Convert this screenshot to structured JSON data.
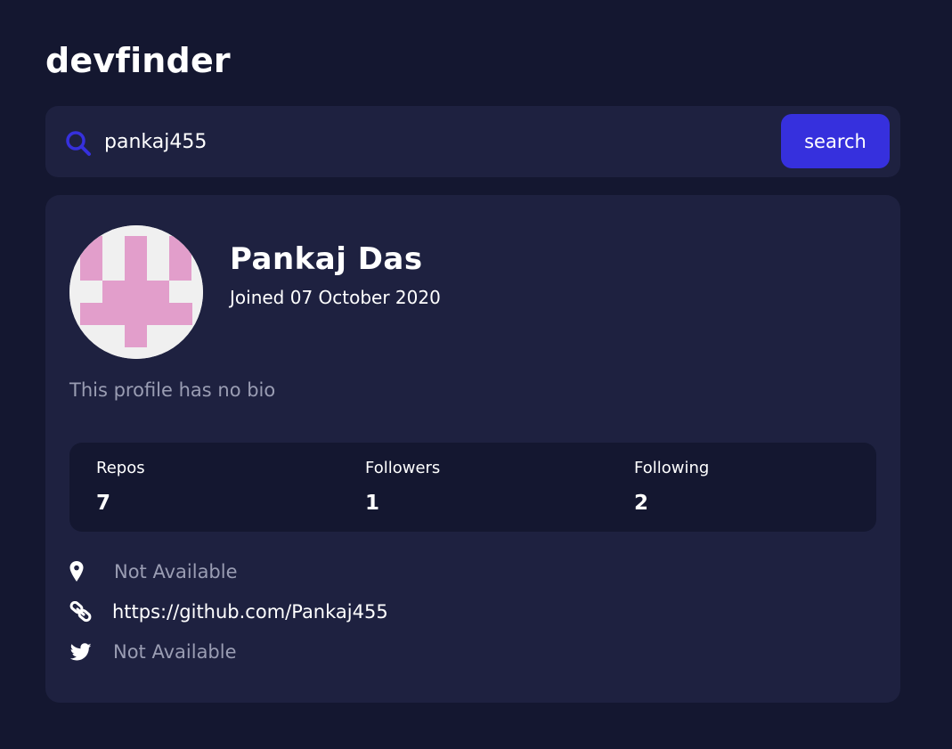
{
  "app": {
    "title": "devfinder"
  },
  "search": {
    "value": "pankaj455",
    "button_label": "search",
    "icon": "search-icon"
  },
  "profile": {
    "name": "Pankaj Das",
    "joined": "Joined 07 October 2020",
    "bio": "This profile has no bio",
    "avatar": "identicon-avatar",
    "stats": {
      "repos_label": "Repos",
      "repos_value": "7",
      "followers_label": "Followers",
      "followers_value": "1",
      "following_label": "Following",
      "following_value": "2"
    },
    "links": {
      "location": "Not Available",
      "website": "https://github.com/Pankaj455",
      "twitter": "Not Available"
    }
  },
  "colors": {
    "page_background": "#141730",
    "card_background": "#1e2140",
    "accent": "#3630dd",
    "muted_text": "#9a9db3",
    "avatar_pink": "#e29ecb",
    "avatar_bg": "#f0f0f0"
  }
}
